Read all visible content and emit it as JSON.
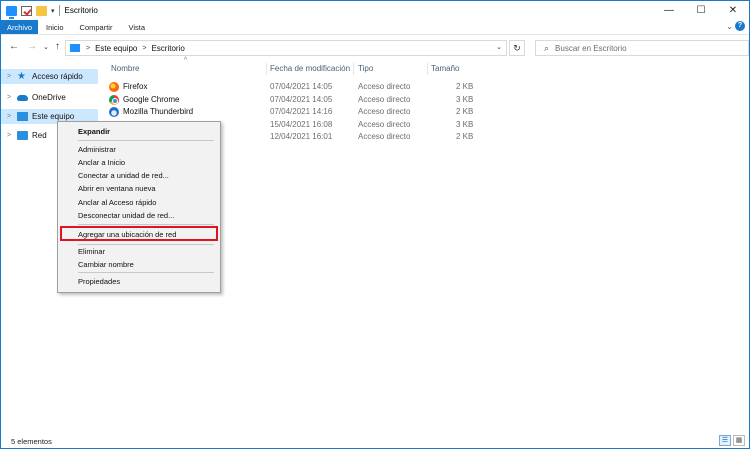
{
  "window": {
    "title": "Escritorio"
  },
  "titlebar": {
    "minimize": "—",
    "maximize": "☐",
    "close": "✕",
    "qa_dropdown": "▾"
  },
  "ribbon": {
    "tabs": [
      "Archivo",
      "Inicio",
      "Compartir",
      "Vista"
    ],
    "expand": "⌄",
    "help": "?"
  },
  "nav": {
    "back": "←",
    "forward": "→",
    "recent": "⌄",
    "up": "↑"
  },
  "address": {
    "crumbs": [
      "Este equipo",
      "Escritorio"
    ],
    "chevron": ">",
    "dropdown": "⌄",
    "refresh": "↻"
  },
  "search": {
    "icon": "⌕",
    "placeholder": "Buscar en Escritorio"
  },
  "navpane": {
    "items": [
      {
        "label": "Acceso rápido",
        "icon": "star-icon",
        "selected": true
      },
      {
        "label": "OneDrive",
        "icon": "cloud-icon",
        "selected": false
      },
      {
        "label": "Este equipo",
        "icon": "computer-icon",
        "selected": true
      },
      {
        "label": "Red",
        "icon": "network-icon",
        "selected": false
      }
    ],
    "arrow": ">"
  },
  "columns": {
    "name": "Nombre",
    "date": "Fecha de modificación",
    "type": "Tipo",
    "size": "Tamaño",
    "sort_indicator": "^"
  },
  "files": [
    {
      "name": "Firefox",
      "date": "07/04/2021 14:05",
      "type": "Acceso directo",
      "size": "2 KB",
      "icon": "firefox-icon"
    },
    {
      "name": "Google Chrome",
      "date": "07/04/2021 14:05",
      "type": "Acceso directo",
      "size": "3 KB",
      "icon": "chrome-icon"
    },
    {
      "name": "Mozilla Thunderbird",
      "date": "07/04/2021 14:16",
      "type": "Acceso directo",
      "size": "2 KB",
      "icon": "thunderbird-icon"
    },
    {
      "name": "",
      "date": "15/04/2021 16:08",
      "type": "Acceso directo",
      "size": "3 KB",
      "icon": ""
    },
    {
      "name": "",
      "date": "12/04/2021 16:01",
      "type": "Acceso directo",
      "size": "2 KB",
      "icon": ""
    }
  ],
  "context_menu": {
    "items": [
      "Expandir",
      "Administrar",
      "Anclar a Inicio",
      "Conectar a unidad de red...",
      "Abrir en ventana nueva",
      "Anclar al Acceso rápido",
      "Desconectar unidad de red...",
      "Agregar una ubicación de red",
      "Eliminar",
      "Cambiar nombre",
      "Propiedades"
    ],
    "highlight_color": "#e0141e"
  },
  "status": {
    "count": "5 elementos",
    "view_details": "☰",
    "view_icons": "▦"
  },
  "colors": {
    "accent": "#1979ca",
    "selection": "#cce8ff"
  }
}
